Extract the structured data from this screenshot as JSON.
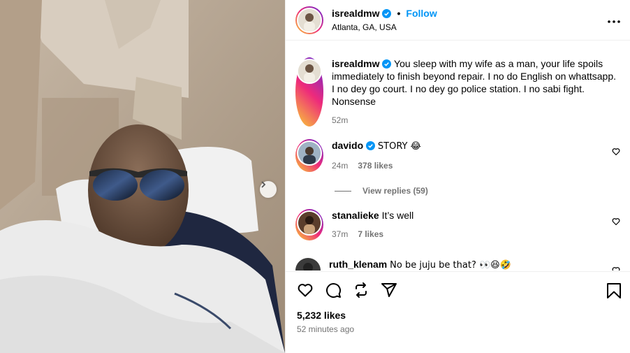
{
  "post": {
    "username": "isrealdmw",
    "separator": "•",
    "follow_label": "Follow",
    "location": "Atlanta, GA, USA",
    "caption": "You sleep with my wife as a man, your life spoils immediately to finish beyond repair. I no do English on whattsapp. I no dey go court. I no dey go police station. I no sabi fight. Nonsense",
    "caption_time": "52m",
    "likes": "5,232 likes",
    "posted_ago": "52 minutes ago"
  },
  "comments": [
    {
      "username": "davido",
      "verified": true,
      "text": "STORY 😂",
      "time": "24m",
      "likes": "378 likes"
    },
    {
      "username": "stanalieke",
      "verified": false,
      "text": "It’s well",
      "time": "37m",
      "likes": "7 likes"
    },
    {
      "username": "ruth_klenam",
      "verified": false,
      "text": "No be juju be that? 👀😆🤣",
      "time": "",
      "likes": ""
    }
  ],
  "view_replies": "View replies (59)",
  "icons": {
    "verified": "verified-badge-icon",
    "more": "more-options-icon",
    "heart": "heart-icon",
    "comment": "comment-icon",
    "repost": "repost-icon",
    "share": "share-icon",
    "save": "bookmark-icon",
    "next": "chevron-right-icon"
  },
  "colors": {
    "accent": "#0095f6",
    "verified": "#0095f6",
    "muted": "#737373"
  }
}
